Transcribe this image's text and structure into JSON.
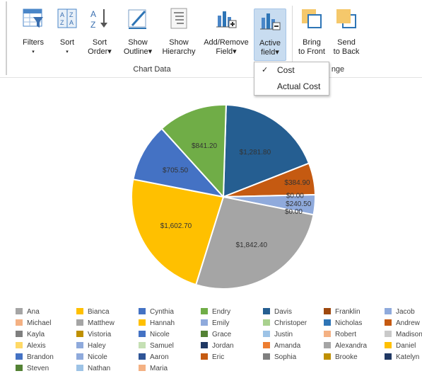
{
  "ribbon": {
    "buttons": [
      {
        "id": "filters",
        "line1": "Filters",
        "line2": "▾",
        "icon": "filter-table-icon"
      },
      {
        "id": "sort",
        "line1": "Sort",
        "line2": "▾",
        "icon": "sort-az-icon"
      },
      {
        "id": "sort-order",
        "line1": "Sort",
        "line2": "Order▾",
        "icon": "sort-order-icon"
      },
      {
        "id": "show-outline",
        "line1": "Show",
        "line2": "Outline▾",
        "icon": "pencil-outline-icon"
      },
      {
        "id": "show-hierarchy",
        "line1": "Show",
        "line2": "Hierarchy",
        "icon": "hierarchy-icon"
      },
      {
        "id": "add-remove-field",
        "line1": "Add/Remove",
        "line2": "Field▾",
        "icon": "add-field-chart-icon"
      },
      {
        "id": "active-field",
        "line1": "Active",
        "line2": "field▾",
        "icon": "active-field-chart-icon"
      },
      {
        "id": "bring-to-front",
        "line1": "Bring",
        "line2": "to Front",
        "icon": "bring-to-front-icon"
      },
      {
        "id": "send-to-back",
        "line1": "Send",
        "line2": "to Back",
        "icon": "send-to-back-icon"
      }
    ],
    "group_chart_data": "Chart Data",
    "group_arrange_partial": "nge"
  },
  "active_field_menu": {
    "items": [
      {
        "label": "Cost",
        "checked": true
      },
      {
        "label": "Actual Cost",
        "checked": false
      }
    ]
  },
  "colors": {
    "blue": "#4472c4",
    "green": "#70ad47",
    "navy": "#255e91",
    "orange": "#c55a11",
    "lightblue": "#8faadc",
    "gray": "#a5a5a5",
    "gold": "#ffc000"
  },
  "chart_data": {
    "type": "pie",
    "slices": [
      {
        "label": "$1,281.80",
        "value": 1281.8,
        "color": "#255e91"
      },
      {
        "label": "$384.90",
        "value": 384.9,
        "color": "#c55a11"
      },
      {
        "label": "$0.00",
        "value": 0.0,
        "color": "#ffffff"
      },
      {
        "label": "$240.50",
        "value": 240.5,
        "color": "#8faadc"
      },
      {
        "label": "$0.00",
        "value": 0.0,
        "color": "#ffffff"
      },
      {
        "label": "$1,842.40",
        "value": 1842.4,
        "color": "#a5a5a5"
      },
      {
        "label": "$1,602.70",
        "value": 1602.7,
        "color": "#ffc000"
      },
      {
        "label": "$705.50",
        "value": 705.5,
        "color": "#4472c4"
      },
      {
        "label": "$841.20",
        "value": 841.2,
        "color": "#70ad47"
      }
    ],
    "legend_placement": "bottom",
    "legend": [
      {
        "name": "Ana",
        "color": "#a5a5a5"
      },
      {
        "name": "Bianca",
        "color": "#ffc000"
      },
      {
        "name": "Cynthia",
        "color": "#4472c4"
      },
      {
        "name": "Endry",
        "color": "#70ad47"
      },
      {
        "name": "Davis",
        "color": "#255e91"
      },
      {
        "name": "Franklin",
        "color": "#9e480e"
      },
      {
        "name": "Jacob",
        "color": "#8faadc"
      },
      {
        "name": "Michael",
        "color": "#f4b183"
      },
      {
        "name": "Matthew",
        "color": "#a5a5a5"
      },
      {
        "name": "Hannah",
        "color": "#ffc000"
      },
      {
        "name": "Emily",
        "color": "#8faadc"
      },
      {
        "name": "Christoper",
        "color": "#a9d18e"
      },
      {
        "name": "Nicholas",
        "color": "#2e75b6"
      },
      {
        "name": "Andrew",
        "color": "#c55a11"
      },
      {
        "name": "Kayla",
        "color": "#7f7f7f"
      },
      {
        "name": "Vistoria",
        "color": "#bf9000"
      },
      {
        "name": "Nicole",
        "color": "#4472c4"
      },
      {
        "name": "Grace",
        "color": "#548235"
      },
      {
        "name": "Justin",
        "color": "#9dc3e6"
      },
      {
        "name": "Robert",
        "color": "#f4b183"
      },
      {
        "name": "Madison",
        "color": "#c9c9c9"
      },
      {
        "name": "Alexis",
        "color": "#ffd966"
      },
      {
        "name": "Haley",
        "color": "#8faadc"
      },
      {
        "name": "Samuel",
        "color": "#c5e0b4"
      },
      {
        "name": "Jordan",
        "color": "#203864"
      },
      {
        "name": "Amanda",
        "color": "#ed7d31"
      },
      {
        "name": "Alexandra",
        "color": "#a5a5a5"
      },
      {
        "name": "Daniel",
        "color": "#ffc000"
      },
      {
        "name": "Brandon",
        "color": "#4472c4"
      },
      {
        "name": "Nicole",
        "color": "#8faadc"
      },
      {
        "name": "Aaron",
        "color": "#2f5597"
      },
      {
        "name": "Eric",
        "color": "#c55a11"
      },
      {
        "name": "Sophia",
        "color": "#7f7f7f"
      },
      {
        "name": "Brooke",
        "color": "#bf9000"
      },
      {
        "name": "Katelyn",
        "color": "#203864"
      },
      {
        "name": "Steven",
        "color": "#548235"
      },
      {
        "name": "Nathan",
        "color": "#9dc3e6"
      },
      {
        "name": "Maria",
        "color": "#f4b183"
      }
    ]
  }
}
